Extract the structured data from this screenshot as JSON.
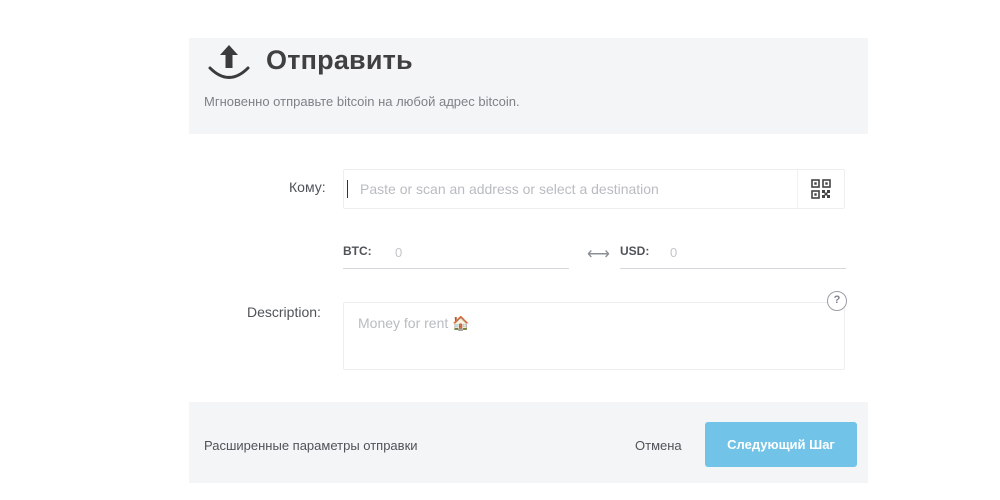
{
  "header": {
    "icon": "send-upload-icon",
    "title": "Отправить",
    "subtitle": "Мгновенно отправьте bitcoin на любой адрес bitcoin."
  },
  "form": {
    "to_label": "Кому:",
    "address_placeholder": "Paste or scan an address or select a destination",
    "address_value": "",
    "qr_icon": "qr-code-icon",
    "btc_label": "BTC:",
    "btc_placeholder": "0",
    "swap_icon": "swap-arrows-icon",
    "usd_label": "USD:",
    "usd_placeholder": "0",
    "description_label": "Description:",
    "description_placeholder": "Money for rent 🏠",
    "help_icon": "?"
  },
  "footer": {
    "advanced_label": "Расширенные параметры отправки",
    "cancel_label": "Отмена",
    "next_label": "Следующий Шаг"
  },
  "colors": {
    "accent": "#72c3e8",
    "panel_bg": "#f4f5f7",
    "text": "#4a4a4a",
    "muted": "#7d8288"
  }
}
